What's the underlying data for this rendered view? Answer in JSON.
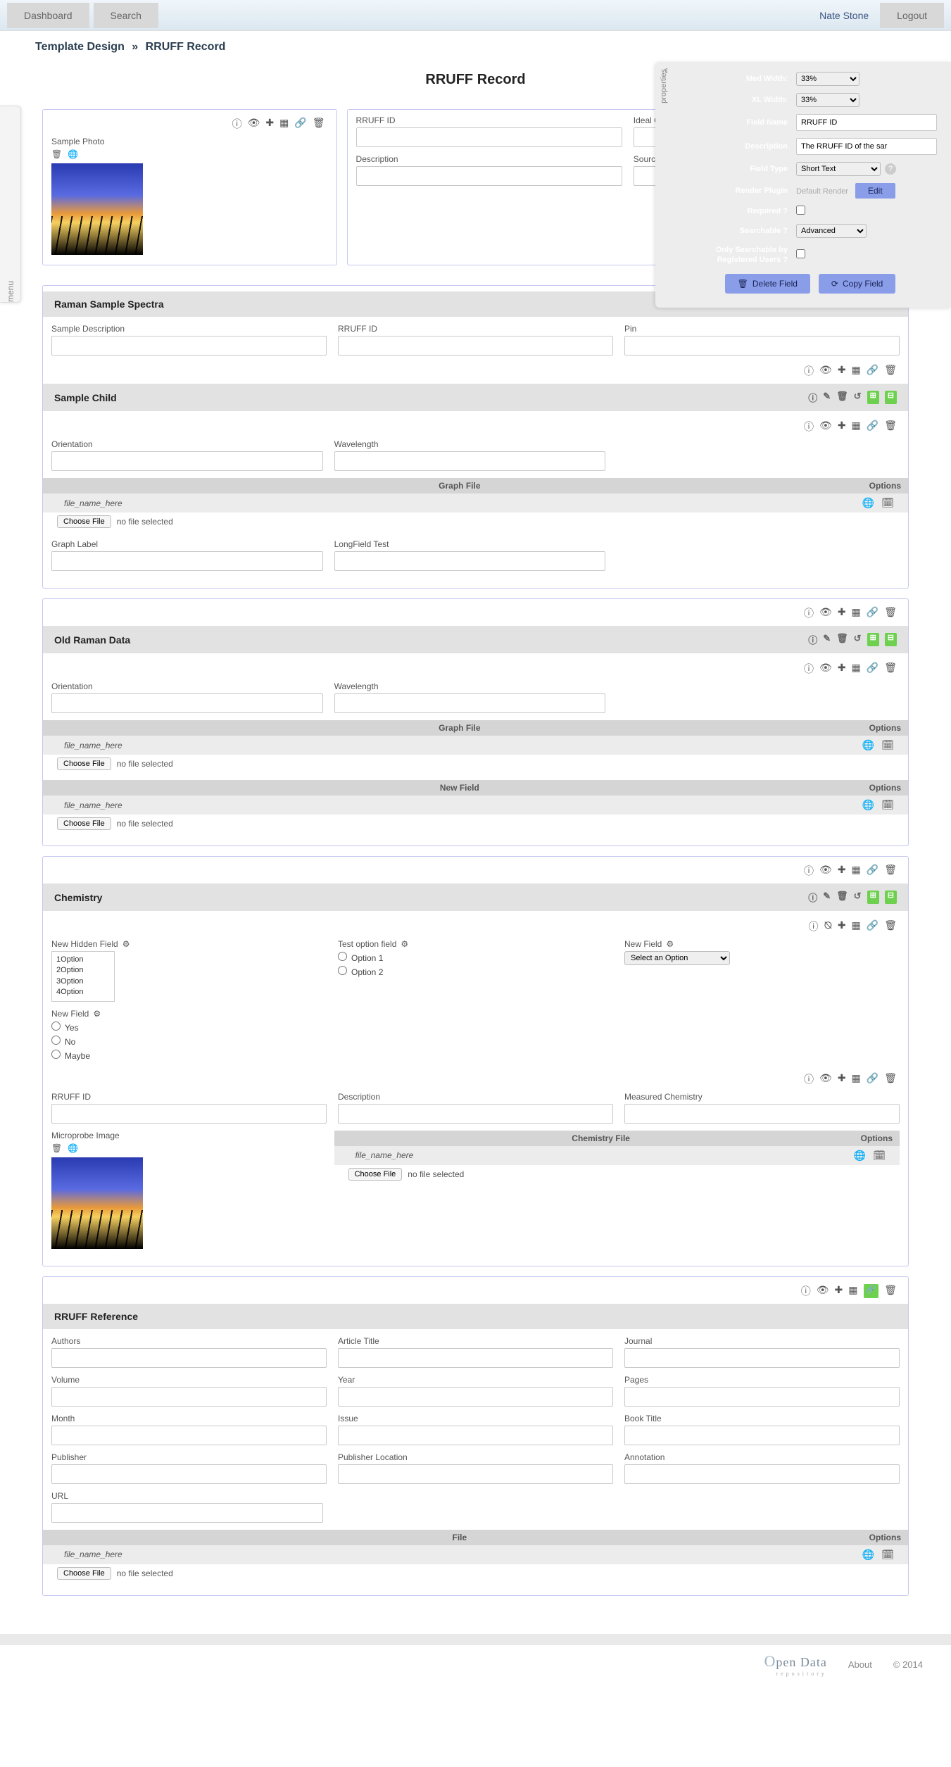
{
  "topbar": {
    "dashboard": "Dashboard",
    "search": "Search",
    "user": "Nate Stone",
    "logout": "Logout"
  },
  "breadcrumb": {
    "a": "Template Design",
    "b": "RRUFF Record"
  },
  "page_title": "RRUFF Record",
  "menu_tab": "menu",
  "props": {
    "tab": "properties",
    "med_width": {
      "label": "Med Width:",
      "value": "33%"
    },
    "xl_width": {
      "label": "XL Width:",
      "value": "33%"
    },
    "field_name": {
      "label": "Field Name",
      "value": "RRUFF ID"
    },
    "description": {
      "label": "Description",
      "value": "The RRUFF ID of the sar"
    },
    "field_type": {
      "label": "Field Type",
      "value": "Short Text"
    },
    "render_plugin": {
      "label": "Render Plugin",
      "value": "Default Render",
      "edit": "Edit"
    },
    "required": {
      "label": "Required ?"
    },
    "searchable": {
      "label": "Searchable ?",
      "value": "Advanced"
    },
    "only_reg": {
      "label": "Only Searchable by Registered Users ?"
    },
    "delete_btn": "Delete Field",
    "copy_btn": "Copy Field"
  },
  "sample_photo": {
    "label": "Sample Photo"
  },
  "rruff_head": {
    "rruff_id": "RRUFF ID",
    "ideal_chem": "Ideal Chemistry",
    "description": "Description",
    "source": "Source"
  },
  "raman": {
    "title": "Raman Sample Spectra",
    "sample_desc": "Sample Description",
    "rruff_id": "RRUFF ID",
    "pin": "Pin",
    "child_title": "Sample Child",
    "orientation": "Orientation",
    "wavelength": "Wavelength",
    "graph_file": "Graph File",
    "options": "Options",
    "file_name": "file_name_here",
    "choose": "Choose File",
    "nofile": "no file selected",
    "graph_label": "Graph Label",
    "longfield": "LongField Test"
  },
  "oldraman": {
    "title": "Old Raman Data",
    "orientation": "Orientation",
    "wavelength": "Wavelength",
    "graph_file": "Graph File",
    "new_field": "New Field",
    "options": "Options",
    "file_name": "file_name_here",
    "choose": "Choose File",
    "nofile": "no file selected"
  },
  "chemistry": {
    "title": "Chemistry",
    "new_hidden": "New Hidden Field",
    "opts": [
      "1Option",
      "2Option",
      "3Option",
      "4Option"
    ],
    "new_field": "New Field",
    "nf_opts": [
      "Yes",
      "No",
      "Maybe"
    ],
    "test_option": "Test option field",
    "to_opts": [
      "Option 1",
      "Option 2"
    ],
    "new_field2": "New Field",
    "select_option": "Select an Option",
    "rruff_id": "RRUFF ID",
    "description": "Description",
    "measured": "Measured Chemistry",
    "microprobe": "Microprobe Image",
    "chem_file": "Chemistry File",
    "options": "Options",
    "file_name": "file_name_here",
    "choose": "Choose File",
    "nofile": "no file selected"
  },
  "reference": {
    "title": "RRUFF Reference",
    "authors": "Authors",
    "article": "Article Title",
    "journal": "Journal",
    "volume": "Volume",
    "year": "Year",
    "pages": "Pages",
    "month": "Month",
    "issue": "Issue",
    "book": "Book Title",
    "publisher": "Publisher",
    "publoc": "Publisher Location",
    "annotation": "Annotation",
    "url": "URL",
    "file": "File",
    "options": "Options",
    "file_name": "file_name_here",
    "choose": "Choose File",
    "nofile": "no file selected"
  },
  "footer": {
    "brand": "Open Data",
    "sub": "repository",
    "about": "About",
    "copy": "© 2014"
  }
}
